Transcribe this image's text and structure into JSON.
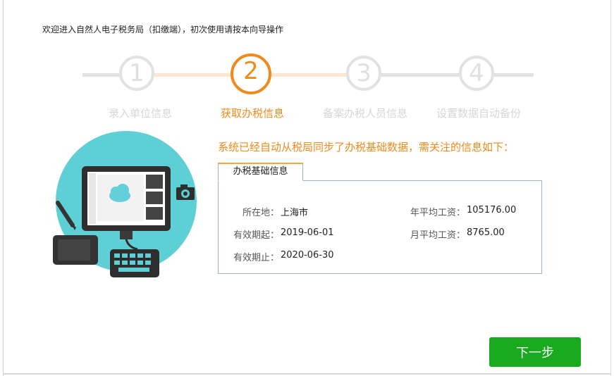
{
  "header": {
    "welcome_text": "欢迎进入自然人电子税务局（扣缴端），初次使用请按本向导操作"
  },
  "steps": [
    {
      "number": "1",
      "label": "录入单位信息",
      "state": "done"
    },
    {
      "number": "2",
      "label": "获取办税信息",
      "state": "active"
    },
    {
      "number": "3",
      "label": "备案办税人员信息",
      "state": "todo"
    },
    {
      "number": "4",
      "label": "设置数据自动备份",
      "state": "todo"
    }
  ],
  "colors": {
    "accent_orange": "#f18a1c",
    "inactive_gray": "#e2e2e2",
    "button_green": "#1aaa1f",
    "illustration_teal": "#5fcfd6"
  },
  "main": {
    "notice": "系统已经自动从税局同步了办税基础数据，需关注的信息如下：",
    "tab_label": "办税基础信息",
    "fields": {
      "location_label": "所在地：",
      "location_value": "上海市",
      "valid_from_label": "有效期起：",
      "valid_from_value": "2019-06-01",
      "valid_to_label": "有效期止：",
      "valid_to_value": "2020-06-30",
      "annual_avg_wage_label": "年平均工资：",
      "annual_avg_wage_value": "105176.00",
      "monthly_avg_wage_label": "月平均工资：",
      "monthly_avg_wage_value": "8765.00"
    }
  },
  "footer": {
    "next_label": "下一步"
  },
  "illustration": {
    "icons": [
      "monitor-icon",
      "cloud-icon",
      "camera-icon",
      "pen-icon",
      "tablet-icon",
      "keyboard-icon"
    ]
  }
}
